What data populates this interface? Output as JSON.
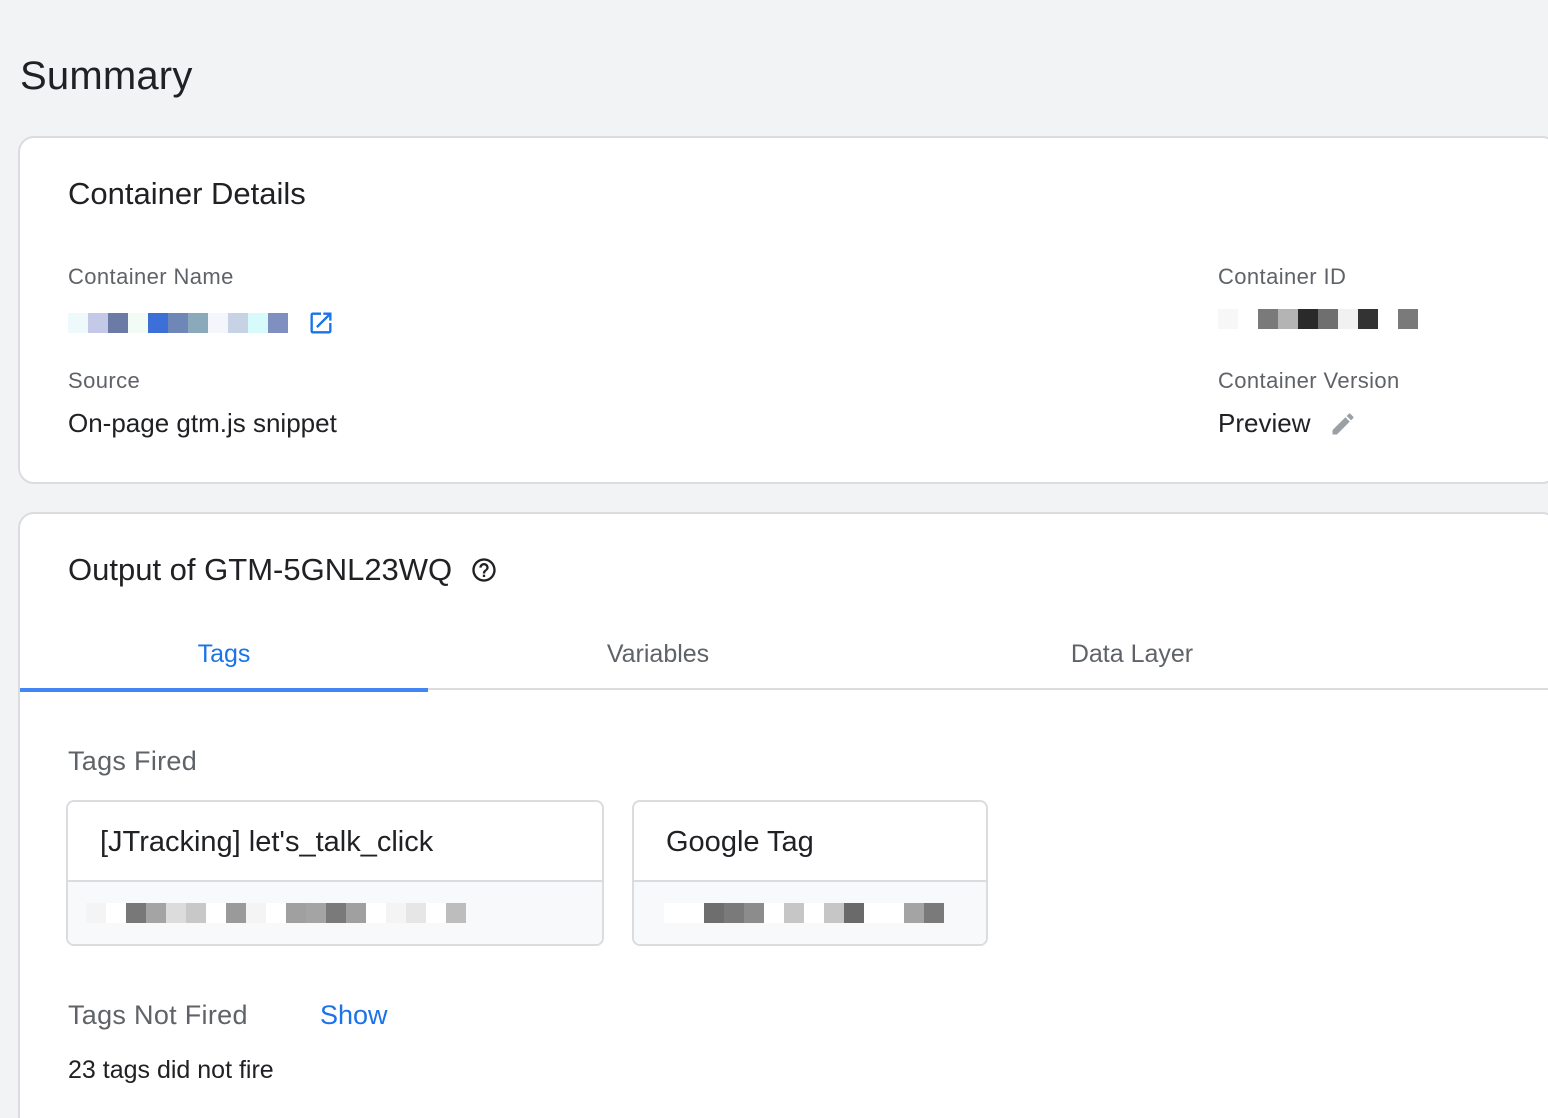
{
  "page": {
    "title": "Summary"
  },
  "container_details": {
    "title": "Container Details",
    "name_label": "Container Name",
    "id_label": "Container ID",
    "source_label": "Source",
    "source_value": "On-page gtm.js snippet",
    "version_label": "Container Version",
    "version_value": "Preview"
  },
  "output": {
    "title": "Output of GTM-5GNL23WQ",
    "tabs": [
      {
        "label": "Tags",
        "active": true
      },
      {
        "label": "Variables",
        "active": false
      },
      {
        "label": "Data Layer",
        "active": false
      }
    ],
    "tags_fired_label": "Tags Fired",
    "fired_tags": [
      {
        "name": "[JTracking] let's_talk_click"
      },
      {
        "name": "Google Tag"
      }
    ],
    "tags_not_fired_label": "Tags Not Fired",
    "show_link": "Show",
    "not_fired_summary": "23 tags did not fire"
  },
  "colors": {
    "accent": "#1a73e8",
    "tab_indicator": "#4285f4",
    "background": "#f1f3f4",
    "border": "#dadce0",
    "muted_text": "#5f6368"
  },
  "icons": {
    "open_external": "open-in-new-icon",
    "edit": "pencil-icon",
    "help": "help-circle-icon"
  }
}
